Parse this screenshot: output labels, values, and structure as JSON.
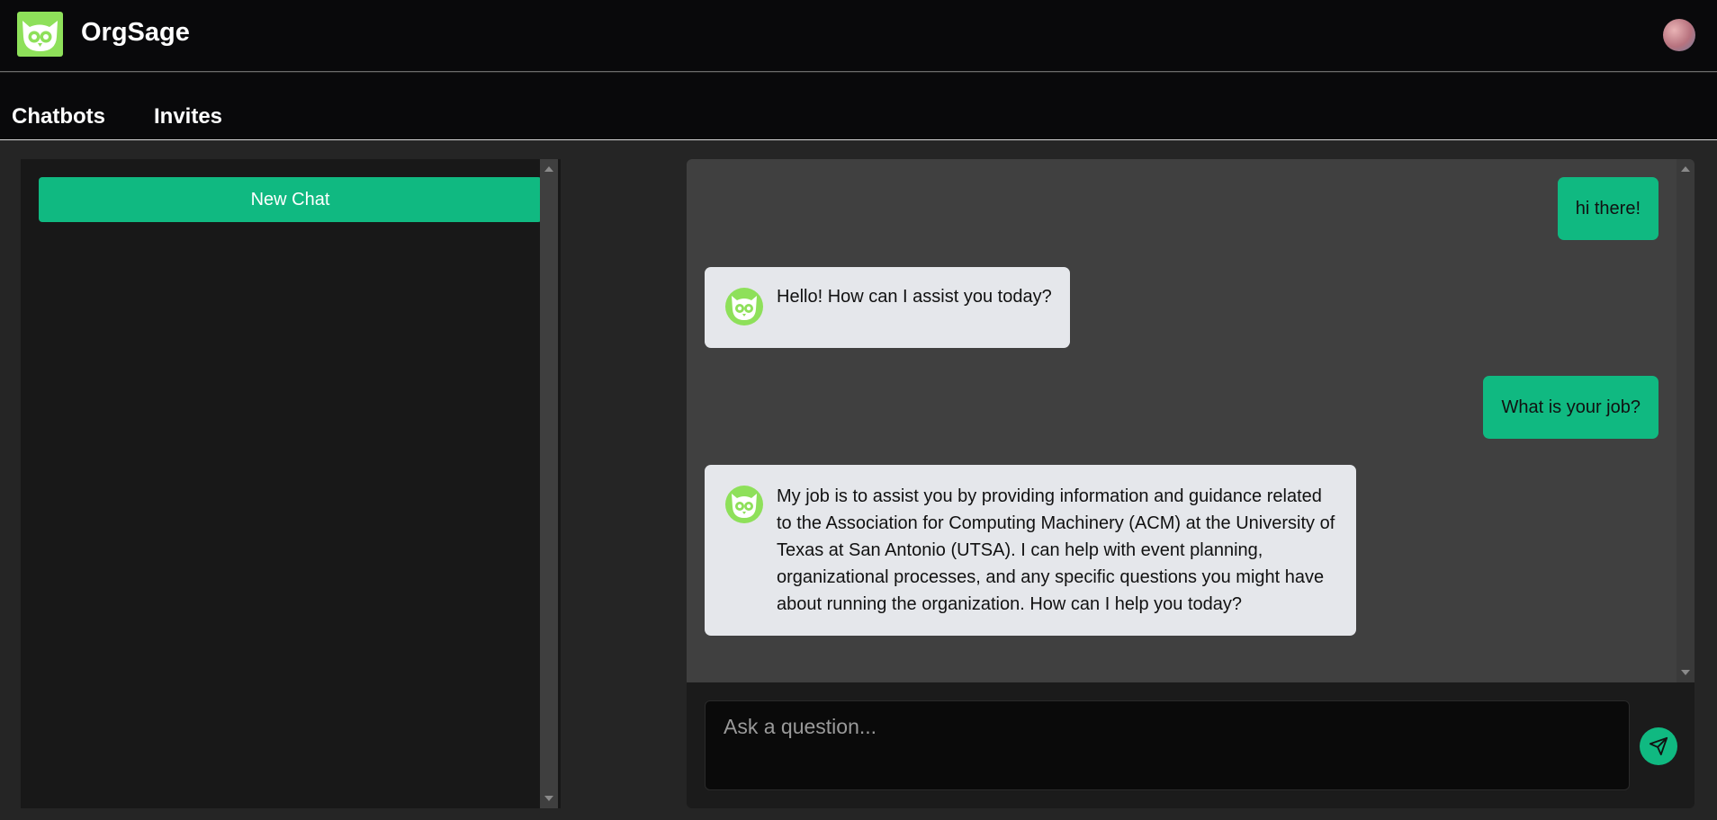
{
  "header": {
    "brand": "OrgSage",
    "logo_icon": "owl-icon"
  },
  "nav": {
    "chatbots": "Chatbots",
    "invites": "Invites"
  },
  "sidebar": {
    "new_chat_label": "New Chat"
  },
  "chat": {
    "messages": [
      {
        "role": "user",
        "text": "hi there!"
      },
      {
        "role": "bot",
        "text": "Hello! How can I assist you today?"
      },
      {
        "role": "user",
        "text": "What is your job?"
      },
      {
        "role": "bot",
        "text": "My job is to assist you by providing information and guidance related to the Association for Computing Machinery (ACM) at the University of Texas at San Antonio (UTSA). I can help with event planning, organizational processes, and any specific questions you might have about running the organization. How can I help you today?"
      }
    ],
    "input_placeholder": "Ask a question...",
    "send_icon": "send-icon"
  },
  "colors": {
    "accent": "#10b981",
    "logo_green": "#8ee05a",
    "bot_bubble": "#e5e7eb",
    "header_bg": "#09090b"
  }
}
